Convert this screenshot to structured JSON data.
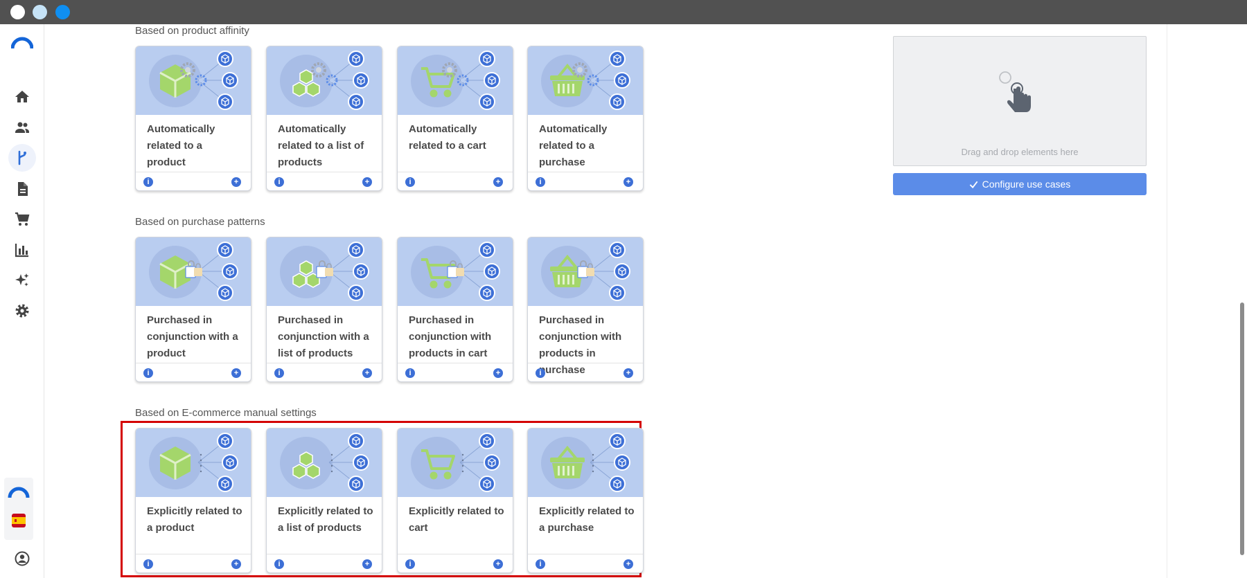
{
  "sections": [
    {
      "title": "Based on product affinity",
      "cards": [
        {
          "title": "Automatically related to a product",
          "icon": "cube-gear-icon"
        },
        {
          "title": "Automatically related to a list of products",
          "icon": "cubes-gear-icon"
        },
        {
          "title": "Automatically related to a cart",
          "icon": "cart-gear-icon"
        },
        {
          "title": "Automatically related to a purchase",
          "icon": "basket-gear-icon"
        }
      ]
    },
    {
      "title": "Based on purchase patterns",
      "cards": [
        {
          "title": "Purchased in conjunction with a product",
          "icon": "cube-lock-icon"
        },
        {
          "title": "Purchased in conjunction with a list of products",
          "icon": "cubes-lock-icon"
        },
        {
          "title": "Purchased in conjunction with products in cart",
          "icon": "cart-lock-icon"
        },
        {
          "title": "Purchased in conjunction with products in purchase",
          "icon": "basket-lock-icon"
        }
      ]
    },
    {
      "title": "Based on E-commerce manual settings",
      "cards": [
        {
          "title": "Explicitly related to a product",
          "icon": "cube-icon"
        },
        {
          "title": "Explicitly related to a list of products",
          "icon": "cubes-icon"
        },
        {
          "title": "Explicitly related to cart",
          "icon": "cart-icon"
        },
        {
          "title": "Explicitly related to a purchase",
          "icon": "basket-icon"
        }
      ]
    }
  ],
  "card_actions": {
    "info_glyph": "i",
    "add_glyph": "+"
  },
  "dropzone": {
    "text": "Drag and drop elements here"
  },
  "configure_button": {
    "label": "Configure use cases"
  },
  "colors": {
    "accent": "#5b8ce8",
    "card_header": "#b9cdf0",
    "green": "#a4d66b",
    "highlight": "#d40000"
  }
}
